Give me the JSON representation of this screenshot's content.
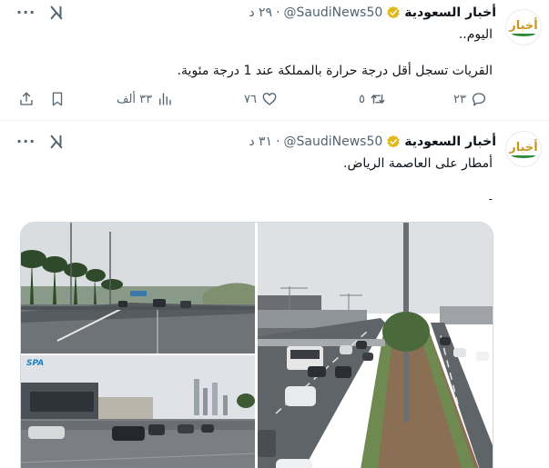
{
  "tweets": [
    {
      "author_name": "أخبار السعودية",
      "handle": "@SaudiNews50",
      "time": "٢٩ د",
      "line1": "اليوم..",
      "line2": "القريات تسجل أقل درجة حرارة بالمملكة عند 1 درجة مئوية.",
      "stats": {
        "replies": "٢٣",
        "retweets": "٥",
        "likes": "٧٦",
        "views": "٣٣ ألف"
      },
      "avatar_text": "أخبار"
    },
    {
      "author_name": "أخبار السعودية",
      "handle": "@SaudiNews50",
      "time": "٣١ د",
      "line1": "أمطار على العاصمة الرياض.",
      "dash": "-",
      "avatar_text": "أخبار",
      "media_watermark": "SPA"
    }
  ],
  "icons": {
    "more": "more-icon",
    "grok": "grok-icon",
    "verified": "verified-badge-icon",
    "reply": "reply-icon",
    "retweet": "retweet-icon",
    "like": "like-icon",
    "views": "views-icon",
    "bookmark": "bookmark-icon",
    "share": "share-icon"
  },
  "colors": {
    "verified_gold": "#e2b719",
    "secondary_text": "#536471",
    "divider": "#eff3f4"
  }
}
